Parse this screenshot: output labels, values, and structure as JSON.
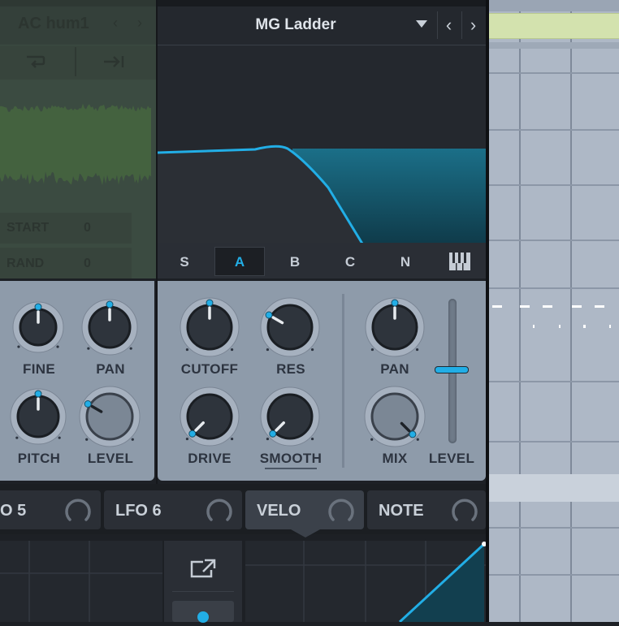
{
  "osc": {
    "preset_name": "AC hum1",
    "start_label": "START",
    "start_value": "0",
    "rand_label": "RAND",
    "rand_value": "0"
  },
  "filter": {
    "type_name": "MG Ladder",
    "routing_tabs": [
      "S",
      "A",
      "B",
      "C",
      "N"
    ],
    "active_tab": "A"
  },
  "osc_knobs": {
    "fine": "FINE",
    "pan": "PAN",
    "pitch": "PITCH",
    "level": "LEVEL"
  },
  "filter_knobs": {
    "cutoff": "CUTOFF",
    "res": "RES",
    "drive": "DRIVE",
    "smooth": "SMOOTH",
    "pan": "PAN",
    "mix": "MIX",
    "level": "LEVEL"
  },
  "mod_tabs": [
    "O 5",
    "LFO 6",
    "VELO",
    "NOTE"
  ],
  "colors": {
    "accent": "#22aee6",
    "panel": "#8e9baa",
    "dark": "#1d2025",
    "grid_bg": "#aeb8c6",
    "clip": "#d3e2ae"
  }
}
